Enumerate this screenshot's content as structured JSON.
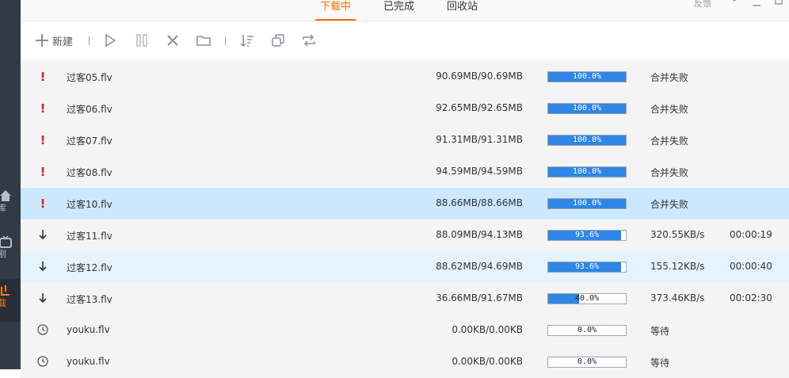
{
  "sidebar": {
    "items": [
      {
        "label": "库",
        "icon": "home-icon"
      },
      {
        "label": "剧",
        "icon": "tv-icon"
      },
      {
        "label": "载",
        "icon": "download-icon",
        "active": true
      }
    ]
  },
  "tabs": [
    {
      "label": "下载中",
      "active": true
    },
    {
      "label": "已完成",
      "active": false
    },
    {
      "label": "回收站",
      "active": false
    }
  ],
  "window": {
    "feedback_label": "反馈"
  },
  "toolbar": {
    "new_label": "新建"
  },
  "colors": {
    "accent": "#ff6a00",
    "progress": "#2f86e4",
    "error": "#e02020",
    "selected_row": "#cce8ff"
  },
  "downloads": [
    {
      "status": "error",
      "name": "过客05.flv",
      "size": "90.69MB/90.69MB",
      "progress": 100,
      "progress_label": "100.0%",
      "speed": "合并失败",
      "eta": ""
    },
    {
      "status": "error",
      "name": "过客06.flv",
      "size": "92.65MB/92.65MB",
      "progress": 100,
      "progress_label": "100.0%",
      "speed": "合并失败",
      "eta": ""
    },
    {
      "status": "error",
      "name": "过客07.flv",
      "size": "91.31MB/91.31MB",
      "progress": 100,
      "progress_label": "100.0%",
      "speed": "合并失败",
      "eta": ""
    },
    {
      "status": "error",
      "name": "过客08.flv",
      "size": "94.59MB/94.59MB",
      "progress": 100,
      "progress_label": "100.0%",
      "speed": "合并失败",
      "eta": ""
    },
    {
      "status": "error",
      "name": "过客10.flv",
      "size": "88.66MB/88.66MB",
      "progress": 100,
      "progress_label": "100.0%",
      "speed": "合并失败",
      "eta": "",
      "selected": true
    },
    {
      "status": "downloading",
      "name": "过客11.flv",
      "size": "88.09MB/94.13MB",
      "progress": 93.6,
      "progress_label": "93.6%",
      "speed": "320.55KB/s",
      "eta": "00:00:19"
    },
    {
      "status": "downloading",
      "name": "过客12.flv",
      "size": "88.62MB/94.69MB",
      "progress": 93.6,
      "progress_label": "93.6%",
      "speed": "155.12KB/s",
      "eta": "00:00:40",
      "hover": true
    },
    {
      "status": "downloading",
      "name": "过客13.flv",
      "size": "36.66MB/91.67MB",
      "progress": 40.0,
      "progress_label": "40.0%",
      "speed": "373.46KB/s",
      "eta": "00:02:30"
    },
    {
      "status": "waiting",
      "name": "youku.flv",
      "size": "0.00KB/0.00KB",
      "progress": 0,
      "progress_label": "0.0%",
      "speed": "等待",
      "eta": ""
    },
    {
      "status": "waiting",
      "name": "youku.flv",
      "size": "0.00KB/0.00KB",
      "progress": 0,
      "progress_label": "0.0%",
      "speed": "等待",
      "eta": ""
    }
  ]
}
